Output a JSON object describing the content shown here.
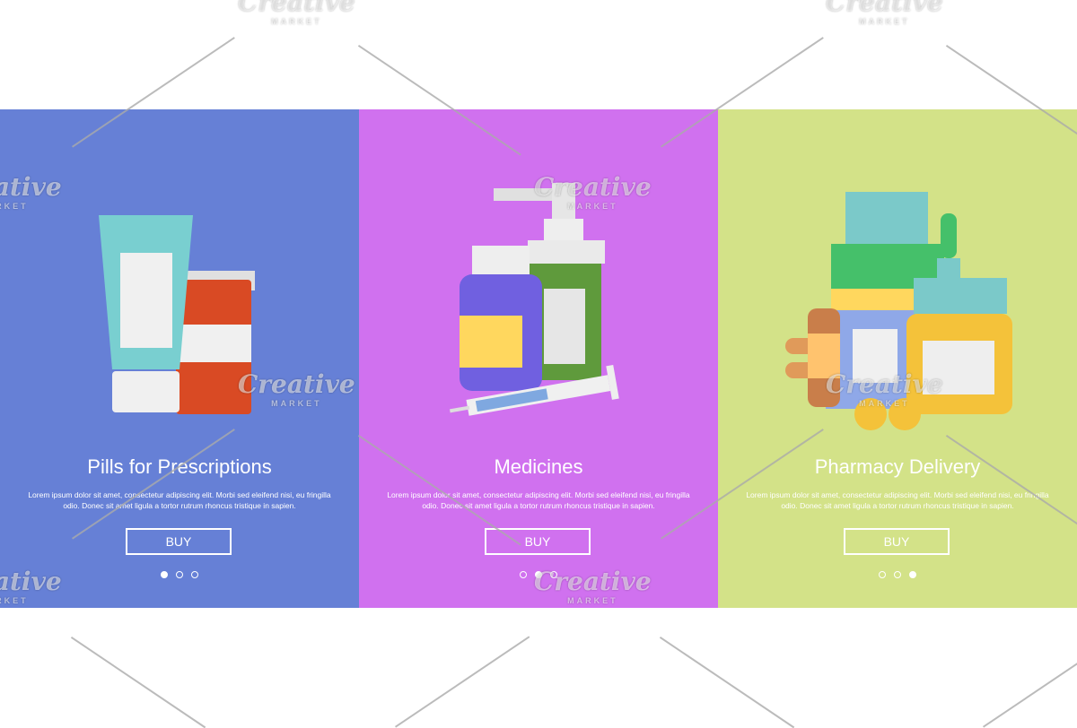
{
  "colors": {
    "blue": "#6680d6",
    "purple": "#d071ef",
    "green": "#d3e288"
  },
  "watermark": {
    "brand": "Creative",
    "sub": "MARKET"
  },
  "panels": [
    {
      "title": "Pills for Prescriptions",
      "desc": "Lorem ipsum dolor sit amet, consectetur adipiscing elit. Morbi sed eleifend nisi, eu fringilla odio. Donec sit amet ligula a tortor rutrum rhoncus tristique in sapien.",
      "button": "BUY",
      "active_dot": 1
    },
    {
      "title": "Medicines",
      "desc": "Lorem ipsum dolor sit amet, consectetur adipiscing elit. Morbi sed eleifend nisi, eu fringilla odio. Donec sit amet ligula a tortor rutrum rhoncus tristique in sapien.",
      "button": "BUY",
      "active_dot": 2
    },
    {
      "title": "Pharmacy Delivery",
      "desc": "Lorem ipsum dolor sit amet, consectetur adipiscing elit. Morbi sed eleifend nisi, eu fringilla odio. Donec sit amet ligula a tortor rutrum rhoncus tristique in sapien.",
      "button": "BUY",
      "active_dot": 3
    }
  ]
}
